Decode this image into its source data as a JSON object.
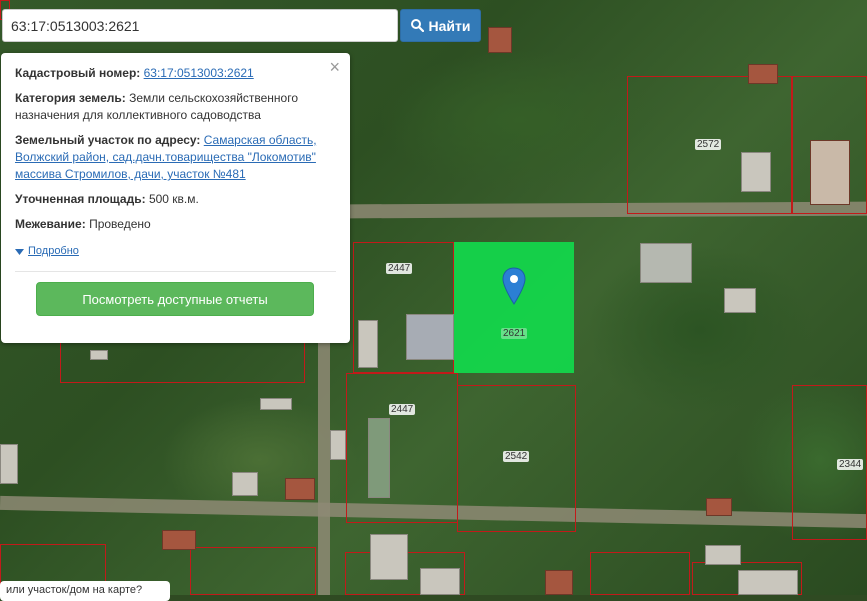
{
  "search": {
    "value": "63:17:0513003:2621",
    "button_label": "Найти"
  },
  "popup": {
    "cadastral_label": "Кадастровый номер:",
    "cadastral_value": "63:17:0513003:2621",
    "category_label": "Категория земель:",
    "category_value": "Земли сельскохозяйственного назначения для коллективного садоводства",
    "address_label": "Земельный участок по адресу:",
    "address_value": "Самарская область, Волжский район, сад.дачн.товарищества \"Локомотив\" массива Стромилов, дачи, участок №481",
    "area_label": "Уточненная площадь:",
    "area_value": "500 кв.м.",
    "survey_label": "Межевание:",
    "survey_value": "Проведено",
    "more_label": "Подробно",
    "report_button": "Посмотреть доступные отчеты",
    "close_symbol": "×"
  },
  "parcels": {
    "p2572": "2572",
    "p2447a": "2447",
    "p2447b": "2447",
    "p2621": "2621",
    "p2542": "2542",
    "p2344": "2344"
  },
  "tooltip": {
    "text": "или участок/дом на карте?"
  },
  "colors": {
    "selected_parcel": "#12d94c",
    "parcel_border": "#c21a1a",
    "search_button": "#337ab7",
    "report_button": "#5cb85c"
  },
  "icons": {
    "search": "search-icon",
    "close": "close-icon",
    "more": "caret-down-icon",
    "marker": "map-marker-icon"
  }
}
